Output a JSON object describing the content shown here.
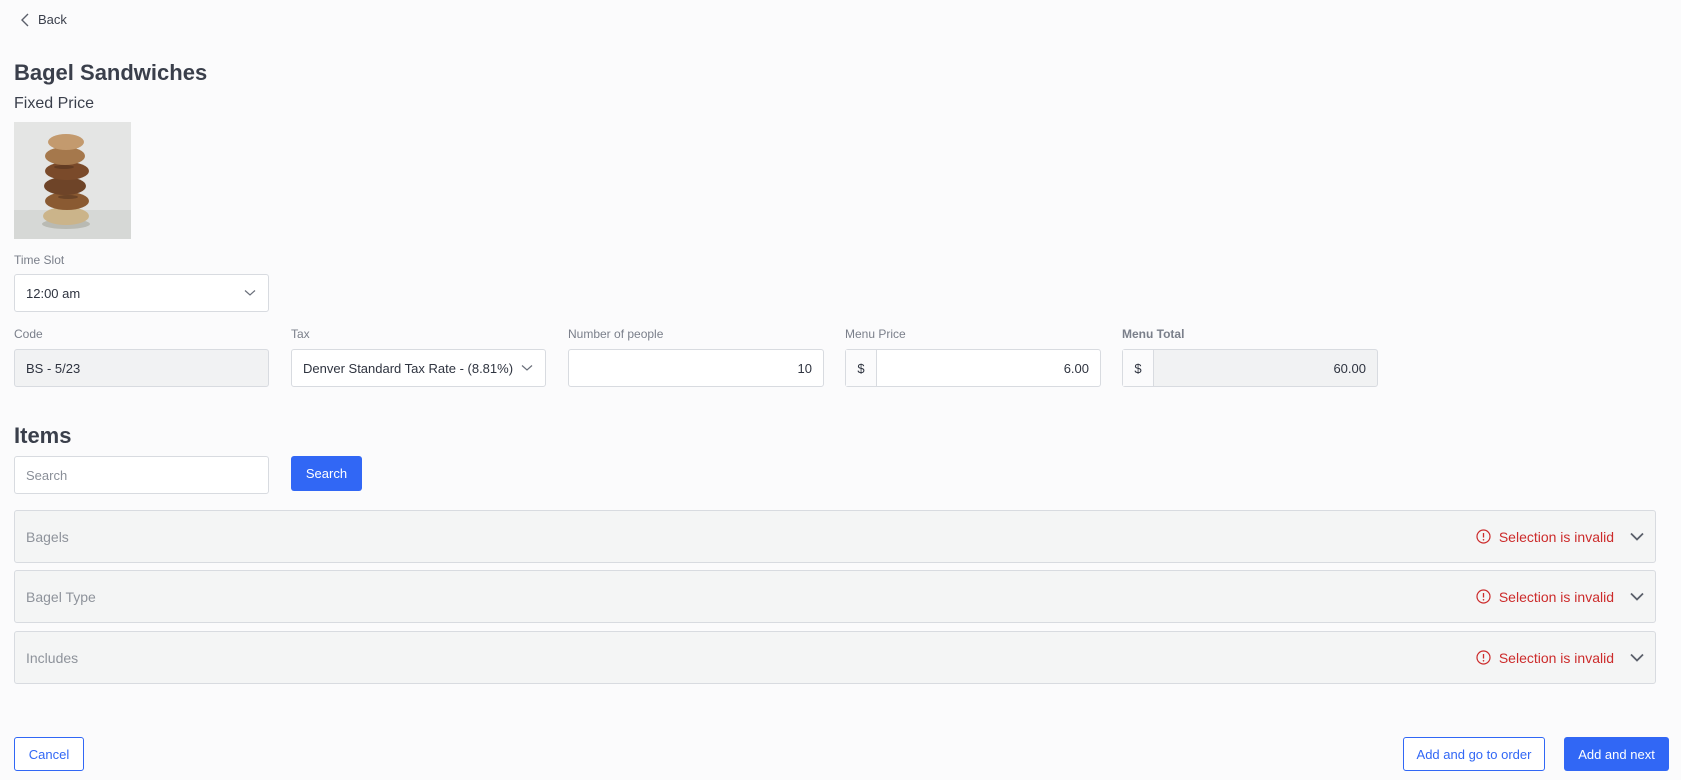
{
  "nav": {
    "back_label": "Back"
  },
  "product": {
    "name": "Bagel Sandwiches",
    "pricing_type": "Fixed Price"
  },
  "time_slot": {
    "label": "Time Slot",
    "value": "12:00 am"
  },
  "code": {
    "label": "Code",
    "value": "BS - 5/23"
  },
  "tax": {
    "label": "Tax",
    "value": "Denver Standard Tax Rate - (8.81%)"
  },
  "people": {
    "label": "Number of people",
    "value": "10"
  },
  "menu_price": {
    "label": "Menu Price",
    "currency": "$",
    "value": "6.00"
  },
  "menu_total": {
    "label": "Menu Total",
    "currency": "$",
    "value": "60.00"
  },
  "items": {
    "title": "Items",
    "search_placeholder": "Search",
    "search_button": "Search",
    "sections": [
      {
        "name": "Bagels",
        "status": "Selection is invalid"
      },
      {
        "name": "Bagel Type",
        "status": "Selection is invalid"
      },
      {
        "name": "Includes",
        "status": "Selection is invalid"
      }
    ]
  },
  "footer": {
    "cancel": "Cancel",
    "add_go_order": "Add and go to order",
    "add_next": "Add and next"
  },
  "colors": {
    "accent": "#3167f5",
    "error": "#cc2b2b",
    "text": "#3a3f4b"
  }
}
